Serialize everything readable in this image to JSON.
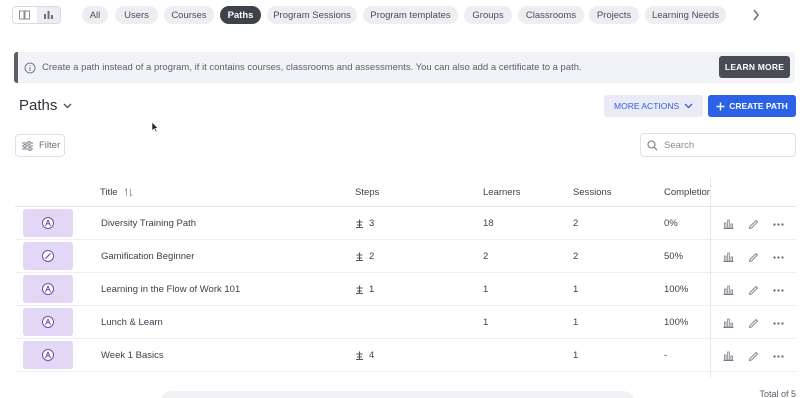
{
  "tabs": [
    {
      "label": "All",
      "active": false
    },
    {
      "label": "Users",
      "active": false
    },
    {
      "label": "Courses",
      "active": false
    },
    {
      "label": "Paths",
      "active": true
    },
    {
      "label": "Program Sessions",
      "active": false
    },
    {
      "label": "Program templates",
      "active": false
    },
    {
      "label": "Groups",
      "active": false
    },
    {
      "label": "Classrooms",
      "active": false
    },
    {
      "label": "Projects",
      "active": false
    },
    {
      "label": "Learning Needs",
      "active": false
    }
  ],
  "banner": {
    "text": "Create a path instead of a program, if it contains courses, classrooms and assessments. You can also add a certificate to a path.",
    "button": "LEARN MORE"
  },
  "header": {
    "title": "Paths",
    "more_actions": "MORE ACTIONS",
    "create": "CREATE PATH"
  },
  "filter": {
    "label": "Filter"
  },
  "search": {
    "placeholder": "Search"
  },
  "table": {
    "columns": [
      "Title",
      "Steps",
      "Learners",
      "Sessions",
      "Completion"
    ],
    "rows": [
      {
        "title": "Diversity Training Path",
        "steps": "3",
        "learners": "18",
        "sessions": "2",
        "completion": "0%",
        "icon": "path-icon"
      },
      {
        "title": "Gamification Beginner",
        "steps": "2",
        "learners": "2",
        "sessions": "2",
        "completion": "50%",
        "icon": "pencil-icon"
      },
      {
        "title": "Learning in the Flow of Work 101",
        "steps": "1",
        "learners": "1",
        "sessions": "1",
        "completion": "100%",
        "icon": "path-icon"
      },
      {
        "title": "Lunch & Learn",
        "steps": "",
        "learners": "1",
        "sessions": "1",
        "completion": "100%",
        "icon": "path-icon"
      },
      {
        "title": "Week 1 Basics",
        "steps": "4",
        "learners": "",
        "sessions": "1",
        "completion": "-",
        "icon": "path-icon"
      }
    ]
  },
  "footer": {
    "total": "Total of 5"
  },
  "colors": {
    "primary": "#2b62e8",
    "thumb": "#e3d7f6",
    "active_chip": "#3f424b"
  }
}
